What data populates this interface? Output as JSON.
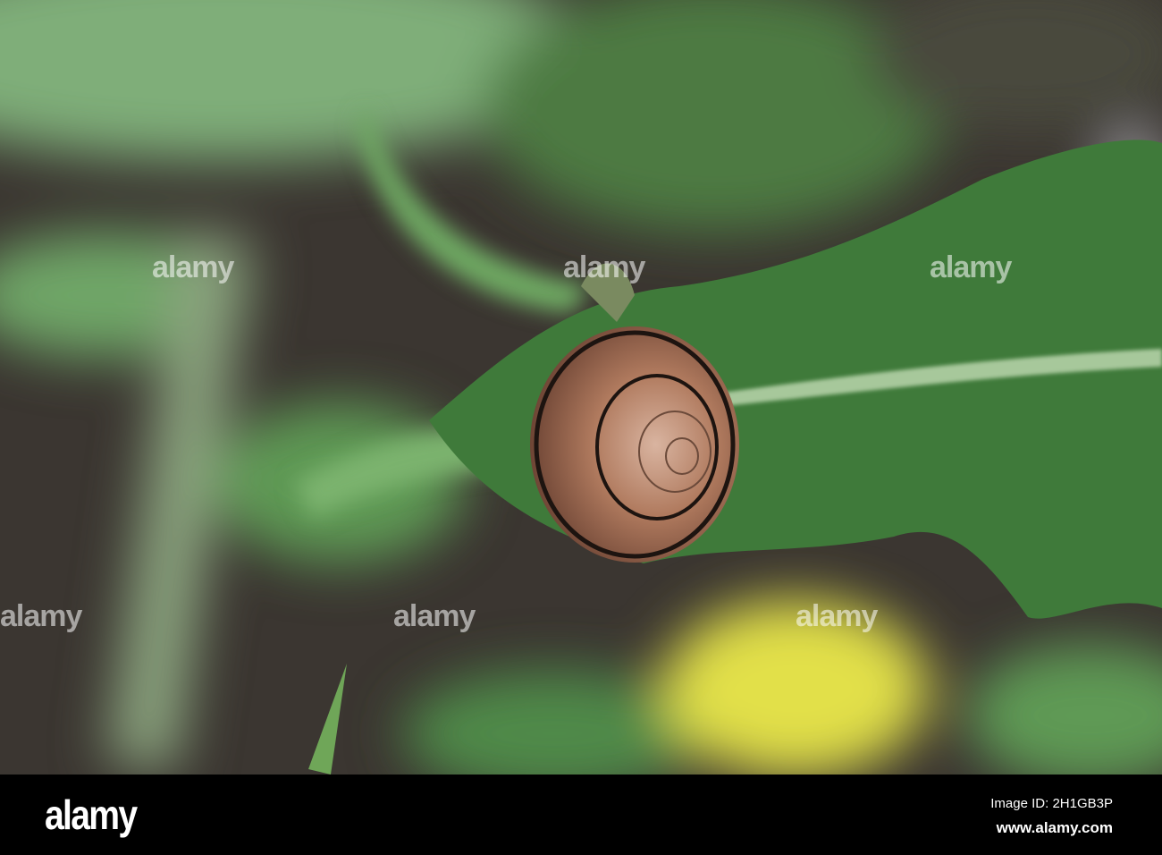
{
  "photo": {
    "subject": "snail",
    "watermark_text": "alamy"
  },
  "footer": {
    "logo": "alamy",
    "image_id": "Image ID: 2H1GB3P",
    "url": "www.alamy.com"
  },
  "colors": {
    "leaf": "#3f7a3a",
    "soil": "#3a3530",
    "shell": "#b07a5e",
    "highlight": "#e6e24a"
  }
}
